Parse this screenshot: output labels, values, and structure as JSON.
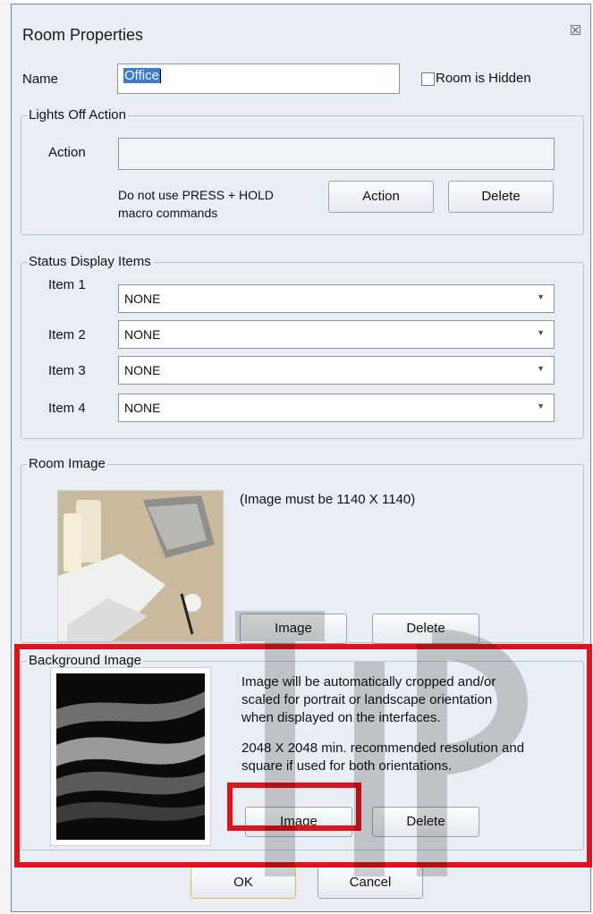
{
  "window": {
    "title": "Room Properties",
    "close_glyph": "☒"
  },
  "name_field": {
    "label": "Name",
    "value": "Office"
  },
  "room_hidden": {
    "label": "Room is Hidden",
    "checked": false
  },
  "lights_off": {
    "legend": "Lights Off Action",
    "action_label": "Action",
    "action_value": "",
    "note_line1": "Do not use PRESS + HOLD",
    "note_line2": "macro commands",
    "action_button": "Action",
    "delete_button": "Delete"
  },
  "status_items": {
    "legend": "Status Display Items",
    "items": [
      {
        "label": "Item 1",
        "value": "NONE"
      },
      {
        "label": "Item 2",
        "value": "NONE"
      },
      {
        "label": "Item 3",
        "value": "NONE"
      },
      {
        "label": "Item 4",
        "value": "NONE"
      }
    ]
  },
  "room_image": {
    "legend": "Room Image",
    "note": "(Image must be 1140 X 1140)",
    "image_button": "Image",
    "delete_button": "Delete"
  },
  "background_image": {
    "legend": "Background Image",
    "note1_line1": "Image will be automatically cropped and/or",
    "note1_line2": "scaled for portrait or landscape orientation",
    "note1_line3": "when displayed on the interfaces.",
    "note2_line1": "2048 X 2048 min. recommended resolution and",
    "note2_line2": "square if used for both orientations.",
    "image_button": "Image",
    "delete_button": "Delete"
  },
  "footer": {
    "ok_button": "OK",
    "cancel_button": "Cancel"
  },
  "colors": {
    "highlight": "#e0121b",
    "dialog_bg": "#e9eef4"
  }
}
